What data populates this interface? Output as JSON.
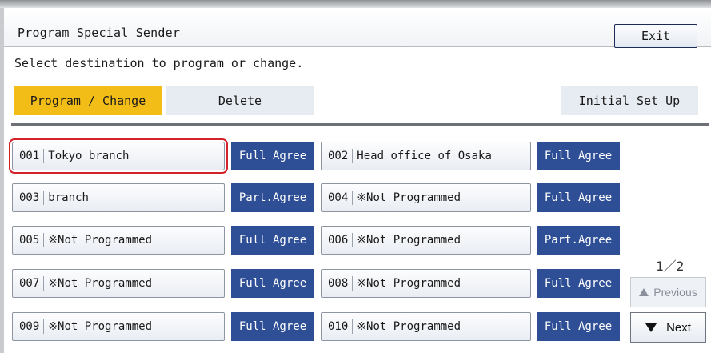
{
  "window": {
    "title": "Program Special Sender",
    "exit_label": "Exit"
  },
  "instruction": "Select destination to program or change.",
  "tabs": {
    "program_change": "Program / Change",
    "delete": "Delete",
    "initial_setup": "Initial Set Up"
  },
  "destinations": [
    {
      "number": "001",
      "name": "Tokyo branch",
      "agree": "Full Agree",
      "selected": true
    },
    {
      "number": "002",
      "name": "Head office of Osaka",
      "agree": "Full Agree"
    },
    {
      "number": "003",
      "name": "branch",
      "agree": "Part.Agree"
    },
    {
      "number": "004",
      "name": "※Not Programmed",
      "agree": "Full Agree"
    },
    {
      "number": "005",
      "name": "※Not Programmed",
      "agree": "Full Agree"
    },
    {
      "number": "006",
      "name": "※Not Programmed",
      "agree": "Part.Agree"
    },
    {
      "number": "007",
      "name": "※Not Programmed",
      "agree": "Full Agree"
    },
    {
      "number": "008",
      "name": "※Not Programmed",
      "agree": "Full Agree"
    },
    {
      "number": "009",
      "name": "※Not Programmed",
      "agree": "Full Agree"
    },
    {
      "number": "010",
      "name": "※Not Programmed",
      "agree": "Full Agree"
    }
  ],
  "pagination": {
    "indicator": "1／2",
    "previous_label": "Previous",
    "next_label": "Next"
  },
  "colors": {
    "active_tab": "#f3bd18",
    "agree_button": "#2e4e96",
    "selection_outline": "#d2232a"
  },
  "icons": {
    "previous": "triangle-up-icon",
    "next": "triangle-down-icon"
  }
}
